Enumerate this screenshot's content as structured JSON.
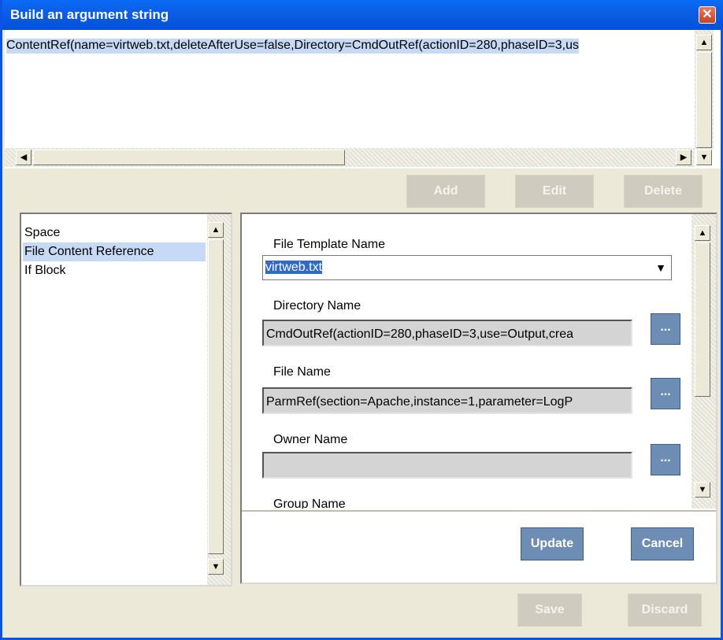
{
  "window": {
    "title": "Build an argument string",
    "close_glyph": "✕"
  },
  "argument": {
    "text": "ContentRef(name=virtweb.txt,deleteAfterUse=false,Directory=CmdOutRef(actionID=280,phaseID=3,us"
  },
  "top_buttons": {
    "add": "Add",
    "edit": "Edit",
    "delete": "Delete"
  },
  "list": {
    "items": [
      {
        "label": "Space"
      },
      {
        "label": "File Content Reference"
      },
      {
        "label": "If Block"
      }
    ],
    "selected_index": 1
  },
  "form": {
    "file_template": {
      "label": "File Template Name",
      "value": "virtweb.txt"
    },
    "directory": {
      "label": "Directory Name",
      "value": "CmdOutRef(actionID=280,phaseID=3,use=Output,crea"
    },
    "file_name": {
      "label": "File Name",
      "value": "ParmRef(section=Apache,instance=1,parameter=LogP"
    },
    "owner": {
      "label": "Owner Name",
      "value": ""
    },
    "group": {
      "label": "Group Name"
    },
    "browse_label": "..."
  },
  "panel_buttons": {
    "update": "Update",
    "cancel": "Cancel"
  },
  "bottom_buttons": {
    "save": "Save",
    "discard": "Discard"
  },
  "icons": {
    "up": "▲",
    "down": "▼",
    "left": "◀",
    "right": "▶"
  },
  "colors": {
    "titlebar": "#0a5fe6",
    "selection": "#c6daf6",
    "active_button": "#6d8db5",
    "disabled_button": "#cfccbf"
  }
}
